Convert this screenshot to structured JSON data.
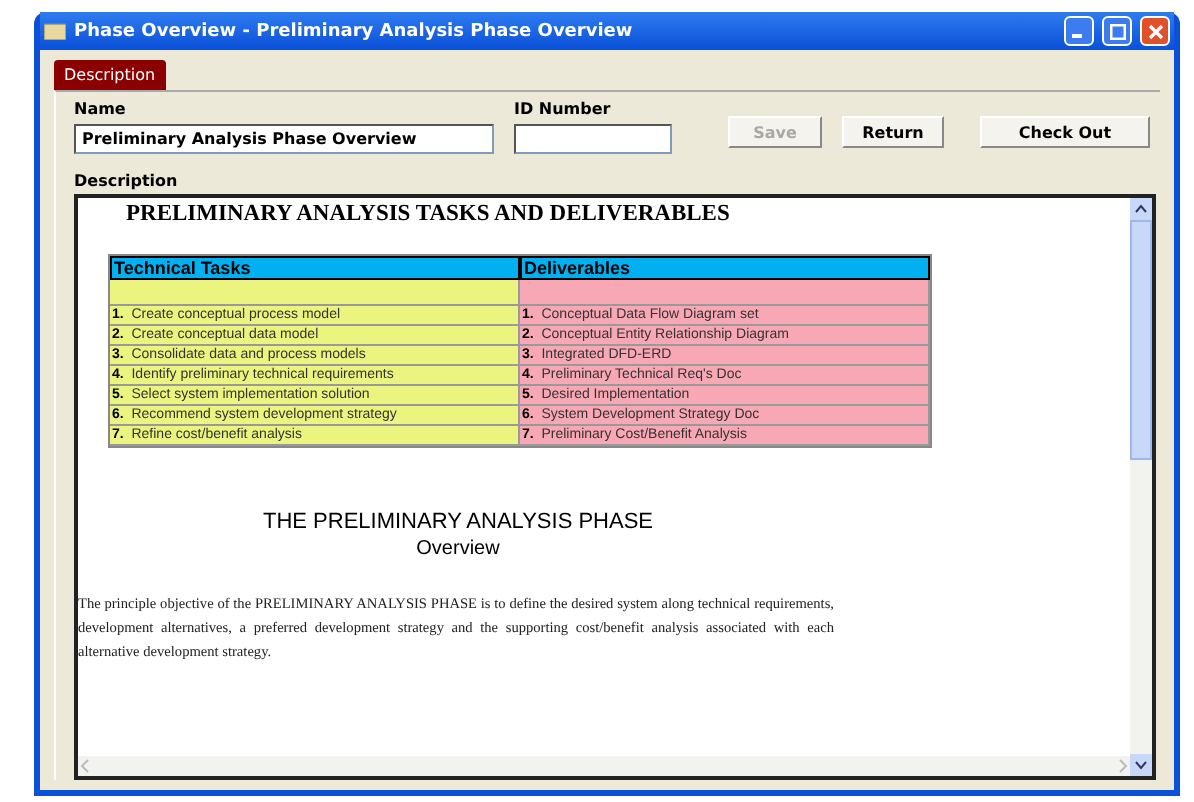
{
  "window": {
    "title": "Phase Overview - Preliminary Analysis Phase Overview"
  },
  "tabs": [
    {
      "label": "Description",
      "selected": true
    }
  ],
  "form": {
    "name_label": "Name",
    "name_value": "Preliminary Analysis Phase Overview",
    "id_label": "ID Number",
    "description_label": "Description"
  },
  "buttons": [
    {
      "label": "Save",
      "disabled": true
    },
    {
      "label": "Return",
      "disabled": false
    },
    {
      "label": "Check Out",
      "disabled": false
    }
  ],
  "document": {
    "heading": "PRELIMINARY ANALYSIS TASKS AND DELIVERABLES",
    "table": {
      "columns": [
        "Technical Tasks",
        "Deliverables"
      ],
      "rows": [
        [
          "**1.**  Create conceptual process model",
          "**1.**  Conceptual Data Flow Diagram set"
        ],
        [
          "**2.**  Create conceptual data model",
          "**2.**  Conceptual Entity Relationship Diagram"
        ],
        [
          "**3.**  Consolidate data and process models",
          "**3.**  Integrated DFD-ERD"
        ],
        [
          "**4.**  Identify preliminary technical requirements",
          "**4.**  Preliminary Technical Req's Doc"
        ],
        [
          "**5.**  Select system implementation solution",
          "**5.**  Desired Implementation"
        ],
        [
          "**6.**  Recommend system development strategy",
          "**6.**  System Development Strategy Doc"
        ],
        [
          "**7.**  Refine cost/benefit analysis",
          "**7.**  Preliminary Cost/Benefit Analysis"
        ]
      ]
    },
    "section_title": "THE PRELIMINARY ANALYSIS PHASE",
    "section_subtitle": "Overview",
    "paragraph": "The principle objective of the PRELIMINARY ANALYSIS PHASE is to define the desired system along technical requirements, development alternatives, a preferred development strategy and the supporting cost/benefit analysis associated with each alternative development strategy."
  }
}
